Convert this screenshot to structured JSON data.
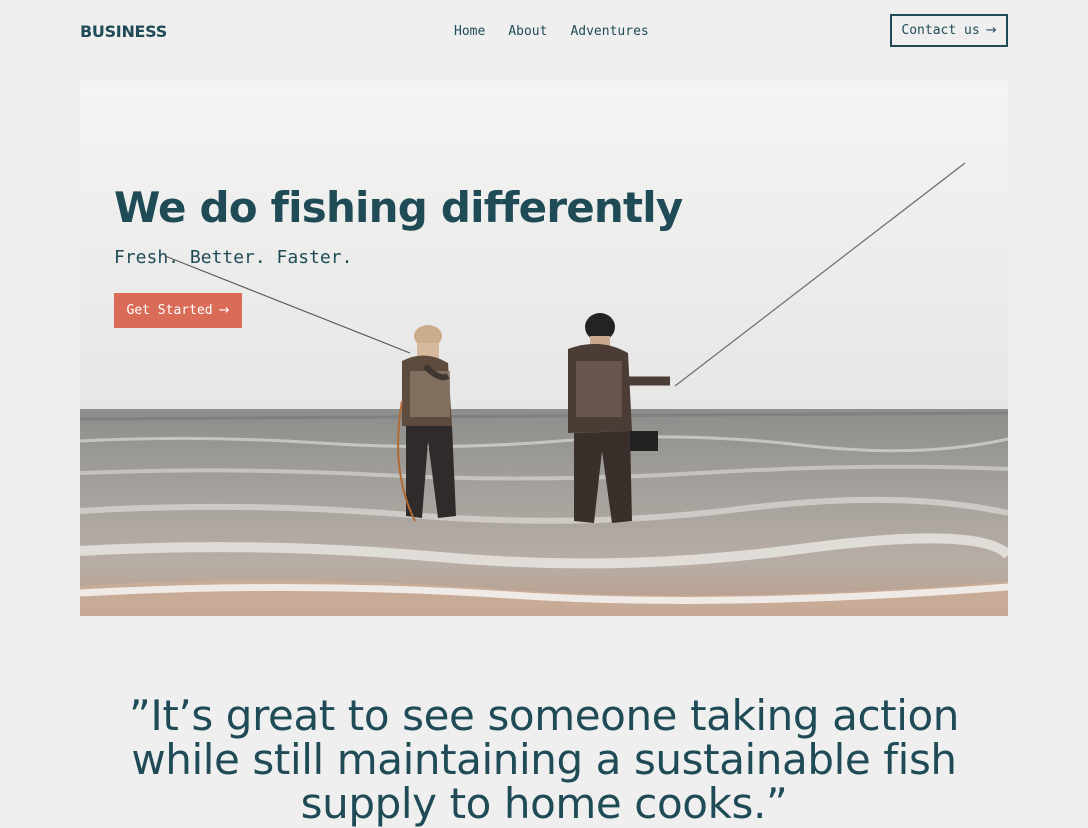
{
  "header": {
    "logo": "BUSINESS",
    "nav": [
      {
        "label": "Home"
      },
      {
        "label": "About"
      },
      {
        "label": "Adventures"
      }
    ],
    "contact_label": "Contact us",
    "contact_icon": "arrow-right-icon"
  },
  "hero": {
    "title": "We do fishing differently",
    "subtitle": "Fresh. Better. Faster.",
    "cta_label": "Get Started",
    "cta_icon": "arrow-right-icon",
    "image_subject": "two anglers fishing in the sea"
  },
  "quote": {
    "text": "”It’s great to see someone taking action while still maintaining a sustainable fish supply to home cooks.”"
  },
  "colors": {
    "page_bg": "#efefef",
    "primary": "#1f4b57",
    "accent": "#d96b57"
  }
}
